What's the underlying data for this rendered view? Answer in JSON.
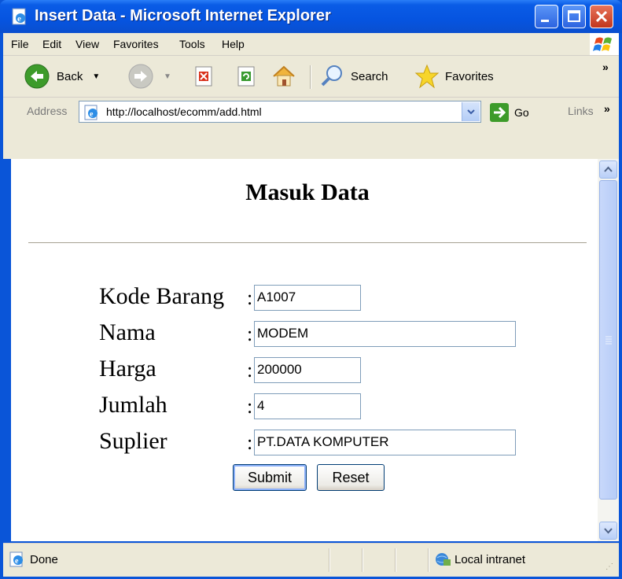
{
  "window": {
    "title": "Insert Data - Microsoft Internet Explorer"
  },
  "menu": {
    "items": [
      "File",
      "Edit",
      "View",
      "Favorites",
      "Tools",
      "Help"
    ]
  },
  "toolbar": {
    "back_label": "Back",
    "search_label": "Search",
    "favorites_label": "Favorites"
  },
  "address": {
    "label": "Address",
    "url": "http://localhost/ecomm/add.html",
    "go_label": "Go",
    "links_label": "Links"
  },
  "page": {
    "heading": "Masuk Data",
    "fields": [
      {
        "label": "Kode Barang",
        "colon": ":",
        "value": "A1007"
      },
      {
        "label": "Nama",
        "colon": ":",
        "value": "MODEM"
      },
      {
        "label": "Harga",
        "colon": ":",
        "value": "200000"
      },
      {
        "label": "Jumlah",
        "colon": ":",
        "value": "4"
      },
      {
        "label": "Suplier",
        "colon": ":",
        "value": "PT.DATA KOMPUTER"
      }
    ],
    "submit_label": "Submit",
    "reset_label": "Reset"
  },
  "status": {
    "text": "Done",
    "zone": "Local intranet"
  },
  "colors": {
    "titlebar": "#0a55d8",
    "chrome": "#ece9d8",
    "input_border": "#7f9db9"
  }
}
